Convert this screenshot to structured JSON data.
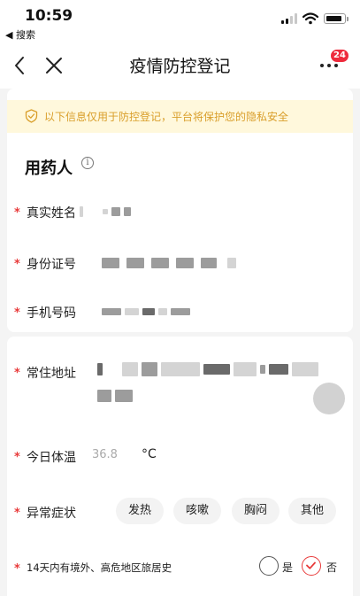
{
  "status_bar": {
    "time": "10:59",
    "back_app": "◀ 搜索"
  },
  "navbar": {
    "title": "疫情防控登记",
    "badge_count": "24"
  },
  "notice": {
    "text": "以下信息仅用于防控登记，平台将保护您的隐私安全"
  },
  "section": {
    "title": "用药人"
  },
  "fields": {
    "name_label": "真实姓名",
    "id_label": "身份证号",
    "phone_label": "手机号码",
    "address_label": "常住地址",
    "temp_label": "今日体温",
    "temp_placeholder": "36.8",
    "temp_unit": "°C",
    "symptom_label": "异常症状",
    "travel_label": "14天内有境外、高危地区旅居史"
  },
  "symptoms": [
    "发热",
    "咳嗽",
    "胸闷",
    "其他"
  ],
  "travel_options": {
    "yes": "是",
    "no": "否",
    "selected": "否"
  },
  "required_mark": "*",
  "colors": {
    "accent": "#e83a3a",
    "notice_bg": "#fff8dc",
    "notice_text": "#d99e2a",
    "badge": "#ee2a3c"
  }
}
